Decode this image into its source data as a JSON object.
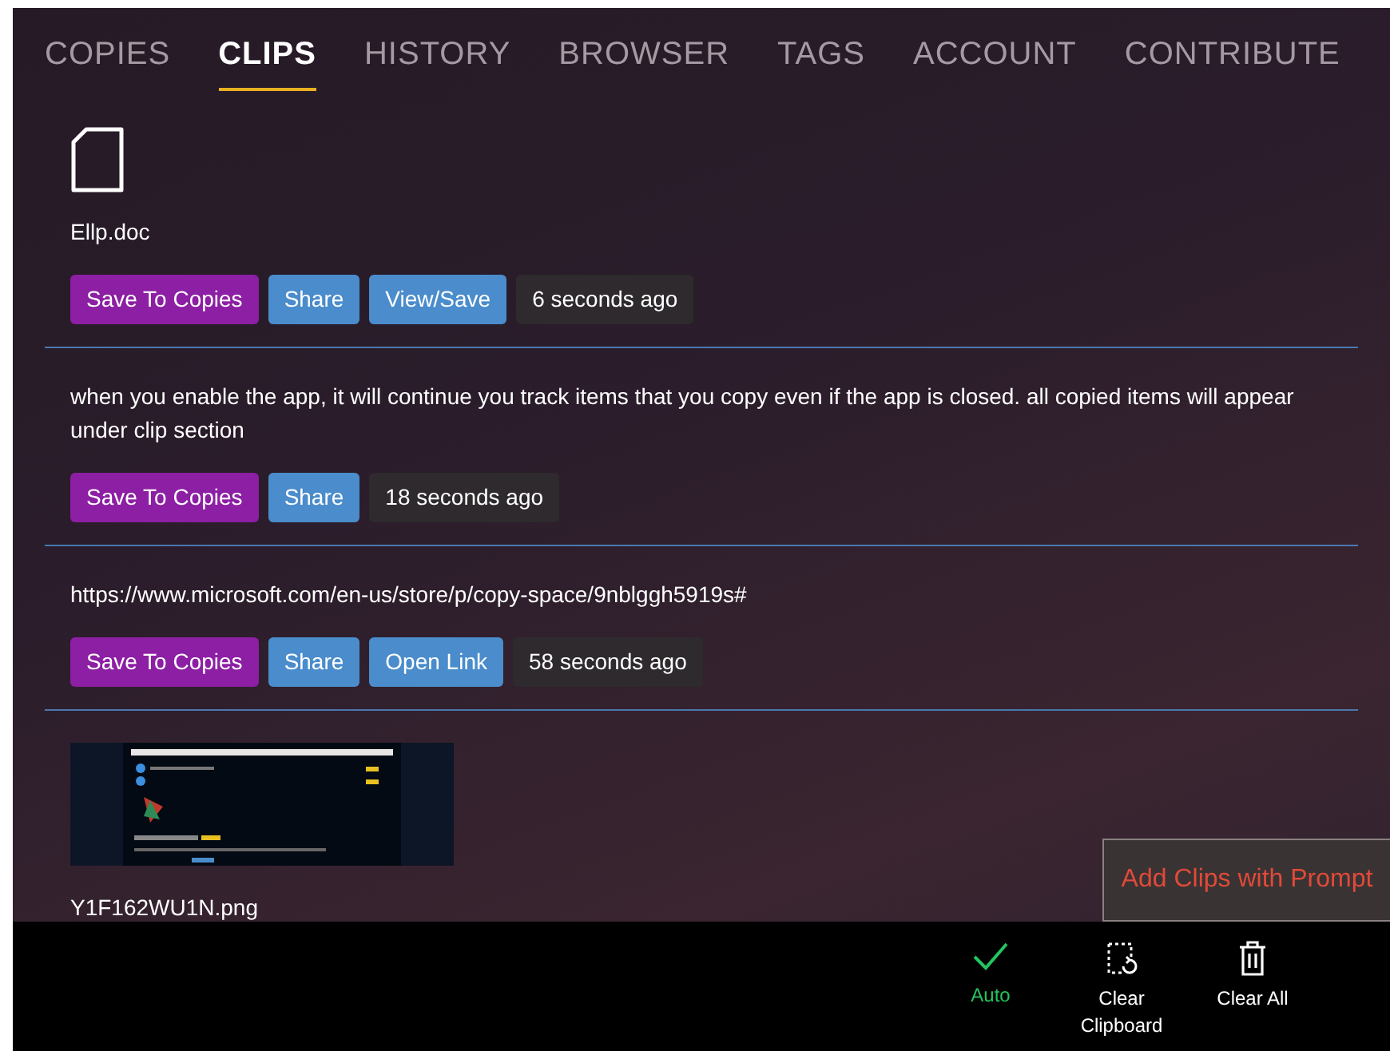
{
  "tabs": [
    {
      "label": "COPIES",
      "selected": false
    },
    {
      "label": "CLIPS",
      "selected": true
    },
    {
      "label": "HISTORY",
      "selected": false
    },
    {
      "label": "BROWSER",
      "selected": false
    },
    {
      "label": "TAGS",
      "selected": false
    },
    {
      "label": "ACCOUNT",
      "selected": false
    },
    {
      "label": "CONTRIBUTE",
      "selected": false
    }
  ],
  "clips": [
    {
      "kind": "file",
      "name": "Ellp.doc",
      "buttons": [
        {
          "kind": "save",
          "label": "Save To Copies"
        },
        {
          "kind": "share",
          "label": "Share"
        },
        {
          "kind": "action",
          "label": "View/Save"
        },
        {
          "kind": "time",
          "label": "6 seconds ago"
        }
      ]
    },
    {
      "kind": "text",
      "text": "when you enable the app, it will continue you track items that you copy even if the app is closed. all copied items will appear under clip section",
      "buttons": [
        {
          "kind": "save",
          "label": "Save To Copies"
        },
        {
          "kind": "share",
          "label": "Share"
        },
        {
          "kind": "time",
          "label": "18 seconds ago"
        }
      ]
    },
    {
      "kind": "text",
      "text": "https://www.microsoft.com/en-us/store/p/copy-space/9nblggh5919s#",
      "buttons": [
        {
          "kind": "save",
          "label": "Save To Copies"
        },
        {
          "kind": "share",
          "label": "Share"
        },
        {
          "kind": "action",
          "label": "Open Link"
        },
        {
          "kind": "time",
          "label": "58 seconds ago"
        }
      ]
    },
    {
      "name": "Y1F162WU1N.png"
    }
  ],
  "prompt_button": "Add Clips with Prompt",
  "bottom_bar": [
    {
      "kind": "check",
      "label": "Auto",
      "on": true
    },
    {
      "kind": "clear",
      "label": "Clear Clipboard",
      "on": false
    },
    {
      "kind": "trash",
      "label": "Clear All",
      "on": false
    }
  ]
}
